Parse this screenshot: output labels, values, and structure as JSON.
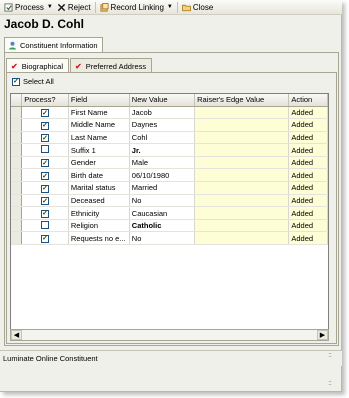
{
  "toolbar": {
    "process_label": "Process",
    "reject_label": "Reject",
    "record_linking_label": "Record Linking",
    "close_label": "Close"
  },
  "title": "Jacob D. Cohl",
  "outer_tab": {
    "label": "Constituent Information"
  },
  "inner_tabs": [
    {
      "label": "Biographical",
      "active": true
    },
    {
      "label": "Preferred Address",
      "active": false
    }
  ],
  "select_all": {
    "label": "Select All",
    "checked": true
  },
  "grid": {
    "columns": [
      "Process?",
      "Field",
      "New Value",
      "Raiser's Edge Value",
      "Action"
    ],
    "rows": [
      {
        "checked": true,
        "field": "First Name",
        "new_value": "Jacob",
        "bold": false,
        "raiser": "",
        "action": "Added"
      },
      {
        "checked": true,
        "field": "Middle Name",
        "new_value": "Daynes",
        "bold": false,
        "raiser": "",
        "action": "Added"
      },
      {
        "checked": true,
        "field": "Last Name",
        "new_value": "Cohl",
        "bold": false,
        "raiser": "",
        "action": "Added"
      },
      {
        "checked": false,
        "field": "Suffix 1",
        "new_value": "Jr.",
        "bold": true,
        "raiser": "",
        "action": "Added"
      },
      {
        "checked": true,
        "field": "Gender",
        "new_value": "Male",
        "bold": false,
        "raiser": "",
        "action": "Added"
      },
      {
        "checked": true,
        "field": "Birth date",
        "new_value": "06/10/1980",
        "bold": false,
        "raiser": "",
        "action": "Added"
      },
      {
        "checked": true,
        "field": "Marital status",
        "new_value": "Married",
        "bold": false,
        "raiser": "",
        "action": "Added"
      },
      {
        "checked": true,
        "field": "Deceased",
        "new_value": "No",
        "bold": false,
        "raiser": "",
        "action": "Added"
      },
      {
        "checked": true,
        "field": "Ethnicity",
        "new_value": "Caucasian",
        "bold": false,
        "raiser": "",
        "action": "Added"
      },
      {
        "checked": false,
        "field": "Religion",
        "new_value": "Catholic",
        "bold": true,
        "raiser": "",
        "action": "Added"
      },
      {
        "checked": true,
        "field": "Requests no e...",
        "new_value": "No",
        "bold": false,
        "raiser": "",
        "action": "Added"
      }
    ]
  },
  "footer": {
    "label": "Luminate Online Constituent"
  },
  "colors": {
    "editable_cell": "#fefed6",
    "tab_check": "#d42020",
    "chrome": "#f0f0ea"
  }
}
